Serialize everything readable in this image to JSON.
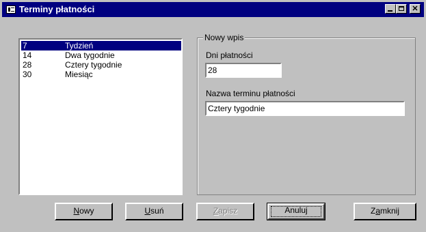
{
  "window": {
    "title": "Terminy płatności"
  },
  "list": {
    "items": [
      {
        "days": "7",
        "name": "Tydzień",
        "selected": true
      },
      {
        "days": "14",
        "name": "Dwa tygodnie",
        "selected": false
      },
      {
        "days": "28",
        "name": "Cztery tygodnie",
        "selected": false
      },
      {
        "days": "30",
        "name": "Miesiąc",
        "selected": false
      }
    ]
  },
  "entry": {
    "group_label": "Nowy wpis",
    "days_label": "Dni płatności",
    "days_value": "28",
    "name_label": "Nazwa terminu płatności",
    "name_value": "Cztery tygodnie"
  },
  "buttons": {
    "new_pre": "",
    "new_u": "N",
    "new_post": "owy",
    "delete_pre": "",
    "delete_u": "U",
    "delete_post": "suń",
    "save_pre": "",
    "save_u": "Z",
    "save_post": "apisz",
    "cancel": "Anuluj",
    "close_pre": "Z",
    "close_u": "a",
    "close_post": "mknij"
  },
  "colors": {
    "titlebar": "#000080",
    "selection": "#000080",
    "face": "#c0c0c0"
  }
}
